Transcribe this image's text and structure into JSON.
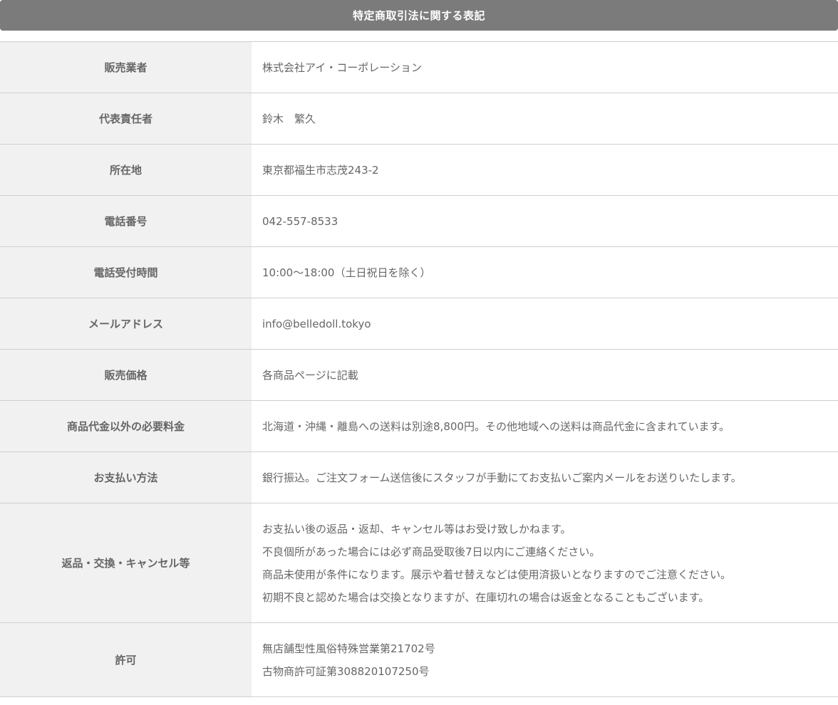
{
  "header": {
    "title": "特定商取引法に関する表記"
  },
  "rows": [
    {
      "label": "販売業者",
      "lines": [
        "株式会社アイ・コーポレーション"
      ]
    },
    {
      "label": "代表責任者",
      "lines": [
        "鈴木　繁久"
      ]
    },
    {
      "label": "所在地",
      "lines": [
        "東京都福生市志茂243-2"
      ]
    },
    {
      "label": "電話番号",
      "lines": [
        "042-557-8533"
      ]
    },
    {
      "label": "電話受付時間",
      "lines": [
        "10:00～18:00（土日祝日を除く）"
      ]
    },
    {
      "label": "メールアドレス",
      "lines": [
        "info@belledoll.tokyo"
      ]
    },
    {
      "label": "販売価格",
      "lines": [
        "各商品ページに記載"
      ]
    },
    {
      "label": "商品代金以外の必要料金",
      "lines": [
        "北海道・沖縄・離島への送料は別途8,800円。その他地域への送料は商品代金に含まれています。"
      ]
    },
    {
      "label": "お支払い方法",
      "lines": [
        "銀行振込。ご注文フォーム送信後にスタッフが手動にてお支払いご案内メールをお送りいたします。"
      ]
    },
    {
      "label": "返品・交換・キャンセル等",
      "lines": [
        "お支払い後の返品・返却、キャンセル等はお受け致しかねます。",
        "不良個所があった場合には必ず商品受取後7日以内にご連絡ください。",
        "商品未使用が条件になります。展示や着せ替えなどは使用済扱いとなりますのでご注意ください。",
        "初期不良と認めた場合は交換となりますが、在庫切れの場合は返金となることもございます。"
      ]
    },
    {
      "label": "許可",
      "lines": [
        "無店舗型性風俗特殊営業第21702号",
        "古物商許可証第308820107250号"
      ]
    }
  ]
}
